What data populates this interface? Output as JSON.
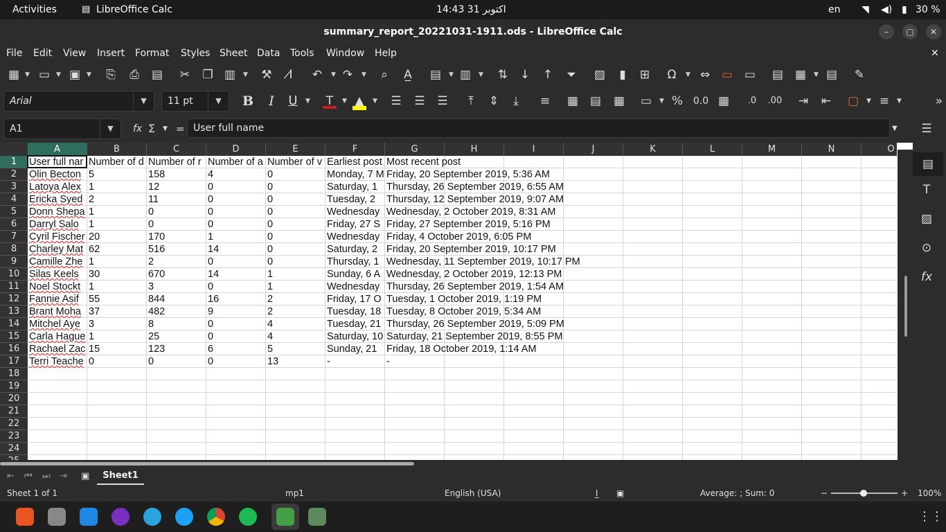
{
  "topbar": {
    "activities": "Activities",
    "app_name": "LibreOffice Calc",
    "clock": "14:43 31 اکتوبر",
    "lang": "en",
    "battery": "30 %"
  },
  "window": {
    "title": "summary_report_20221031-1911.ods - LibreOffice Calc"
  },
  "menu": [
    "File",
    "Edit",
    "View",
    "Insert",
    "Format",
    "Styles",
    "Sheet",
    "Data",
    "Tools",
    "Window",
    "Help"
  ],
  "format_toolbar": {
    "font_name": "Arial",
    "font_size": "11 pt",
    "bold": "B",
    "italic": "I",
    "underline": "U"
  },
  "formula_bar": {
    "name_box": "A1",
    "fx": "fx",
    "sum": "Σ",
    "equals": "=",
    "content": "User full name"
  },
  "columns": [
    "A",
    "B",
    "C",
    "D",
    "E",
    "F",
    "G",
    "H",
    "I",
    "J",
    "K",
    "L",
    "M",
    "N",
    "O"
  ],
  "rows": [
    "1",
    "2",
    "3",
    "4",
    "5",
    "6",
    "7",
    "8",
    "9",
    "10",
    "11",
    "12",
    "13",
    "14",
    "15",
    "16",
    "17",
    "18",
    "19",
    "20",
    "21",
    "22",
    "23",
    "24",
    "25"
  ],
  "sheet": {
    "headers": [
      "User full nar",
      "Number of d",
      "Number of r",
      "Number of a",
      "Number of v",
      "Earliest post",
      "Most recent post"
    ],
    "data": [
      [
        "Olin Becton",
        "5",
        "158",
        "4",
        "0",
        "Monday, 7 M",
        "Friday, 20 September 2019, 5:36 AM"
      ],
      [
        "Latoya Alex",
        "1",
        "12",
        "0",
        "0",
        "Saturday, 1",
        "Thursday, 26 September 2019, 6:55 AM"
      ],
      [
        "Ericka Syed",
        "2",
        "11",
        "0",
        "0",
        "Tuesday, 2",
        "Thursday, 12 September 2019, 9:07 AM"
      ],
      [
        "Donn Shepa",
        "1",
        "0",
        "0",
        "0",
        "Wednesday",
        "Wednesday, 2 October 2019, 8:31 AM"
      ],
      [
        "Darryl Salo",
        "1",
        "0",
        "0",
        "0",
        "Friday, 27 S",
        "Friday, 27 September 2019, 5:16 PM"
      ],
      [
        "Cyril Fischer",
        "20",
        "170",
        "1",
        "0",
        "Wednesday",
        "Friday, 4 October 2019, 6:05 PM"
      ],
      [
        "Charley Mat",
        "62",
        "516",
        "14",
        "0",
        "Saturday, 2",
        "Friday, 20 September 2019, 10:17 PM"
      ],
      [
        "Camille Zhe",
        "1",
        "2",
        "0",
        "0",
        "Thursday, 1",
        "Wednesday, 11 September 2019, 10:17 PM"
      ],
      [
        "Silas Keels",
        "30",
        "670",
        "14",
        "1",
        "Sunday, 6 A",
        "Wednesday, 2 October 2019, 12:13 PM"
      ],
      [
        "Noel Stockt",
        "1",
        "3",
        "0",
        "1",
        "Wednesday",
        "Thursday, 26 September 2019, 1:54 AM"
      ],
      [
        "Fannie Asif",
        "55",
        "844",
        "16",
        "2",
        "Friday, 17 O",
        "Tuesday, 1 October 2019, 1:19 PM"
      ],
      [
        "Brant Moha",
        "37",
        "482",
        "9",
        "2",
        "Tuesday, 18",
        "Tuesday, 8 October 2019, 5:34 AM"
      ],
      [
        "Mitchel Aye",
        "3",
        "8",
        "0",
        "4",
        "Tuesday, 21",
        "Thursday, 26 September 2019, 5:09 PM"
      ],
      [
        "Carla Hague",
        "1",
        "25",
        "0",
        "4",
        "Saturday, 10",
        "Saturday, 21 September 2019, 8:55 PM"
      ],
      [
        "Rachael Zac",
        "15",
        "123",
        "6",
        "5",
        "Sunday, 21",
        "Friday, 18 October 2019, 1:14 AM"
      ],
      [
        "Terri Teache",
        "0",
        "0",
        "0",
        "13",
        "-",
        "-"
      ]
    ]
  },
  "tabs": {
    "sheet_name": "Sheet1"
  },
  "status": {
    "sheet_of": "Sheet 1 of 1",
    "page_style": "mp1",
    "language": "English (USA)",
    "summary": "Average: ; Sum: 0",
    "zoom_minus": "−",
    "zoom_plus": "+",
    "zoom": "100%"
  },
  "colors": {
    "selected_header": "#2f6d5f",
    "chrome": "#2c2c2c"
  }
}
